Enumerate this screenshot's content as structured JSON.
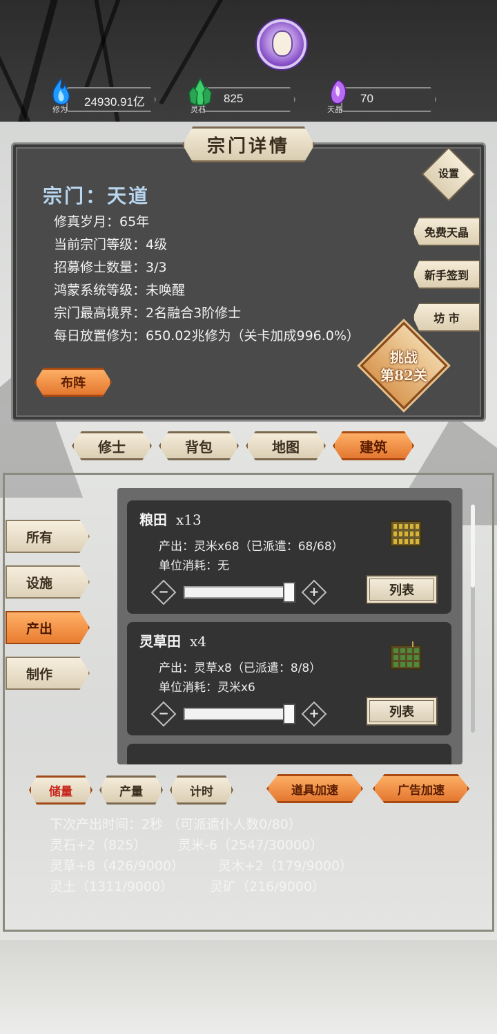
{
  "header": {
    "resources": [
      {
        "icon": "blue-flame-icon",
        "value": "24930.91亿",
        "caption": "修为"
      },
      {
        "icon": "green-crystal-icon",
        "value": "825",
        "caption": "灵石"
      },
      {
        "icon": "purple-gem-icon",
        "value": "70",
        "caption": "天晶"
      }
    ]
  },
  "sect_panel": {
    "title": "宗门详情",
    "sect_name": "宗门：天道",
    "settings_label": "设置",
    "info": [
      "修真岁月：65年",
      "当前宗门等级：4级",
      "招募修士数量：3/3",
      "鸿蒙系统等级：未唤醒",
      "宗门最高境界：2名融合3阶修士",
      "每日放置修为：650.02兆修为（关卡加成996.0%）"
    ],
    "side_buttons": [
      "免费天晶",
      "新手签到",
      "坊 市"
    ],
    "formation_label": "布阵",
    "challenge_line1": "挑战",
    "challenge_line2": "第82关"
  },
  "main_tabs": [
    {
      "label": "修士",
      "active": false
    },
    {
      "label": "背包",
      "active": false
    },
    {
      "label": "地图",
      "active": false
    },
    {
      "label": "建筑",
      "active": true
    }
  ],
  "categories": [
    {
      "label": "所有",
      "active": false
    },
    {
      "label": "设施",
      "active": false
    },
    {
      "label": "产出",
      "active": true
    },
    {
      "label": "制作",
      "active": false
    }
  ],
  "buildings": [
    {
      "name": "粮田",
      "count": "x13",
      "output": "产出：灵米x68（已派遣：68/68）",
      "cost": "单位消耗：无",
      "slider_fill": 1.0,
      "list_label": "列表",
      "icon": "rice-field-icon"
    },
    {
      "name": "灵草田",
      "count": "x4",
      "output": "产出：灵草x8（已派遣：8/8）",
      "cost": "单位消耗：灵米x6",
      "slider_fill": 1.0,
      "list_label": "列表",
      "icon": "herb-field-icon"
    }
  ],
  "sub_tabs": [
    {
      "label": "储量",
      "active": true
    },
    {
      "label": "产量",
      "active": false
    },
    {
      "label": "计时",
      "active": false
    }
  ],
  "speed_buttons": [
    "道具加速",
    "广告加速"
  ],
  "stats": {
    "next_output": "下次产出时间：2秒 （可派遣仆人数0/80）",
    "row1_a": "灵石+2（825）",
    "row1_b": "灵米-6（2547/30000）",
    "row2_a": "灵草+8（426/9000）",
    "row2_b": "灵木+2（179/9000）",
    "row3_a": "灵土（1311/9000）",
    "row3_b": "灵矿（216/9000）"
  }
}
